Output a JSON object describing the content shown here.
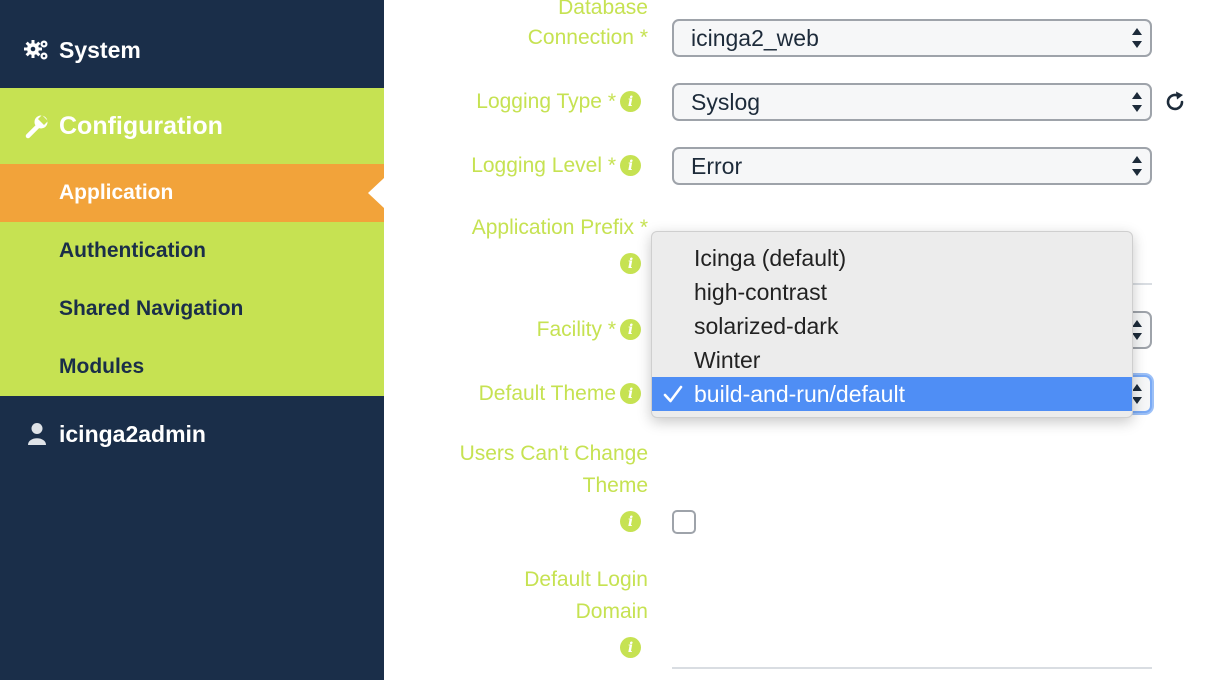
{
  "sidebar": {
    "system_label": "System",
    "configuration_label": "Configuration",
    "sub_items": [
      {
        "label": "Application"
      },
      {
        "label": "Authentication"
      },
      {
        "label": "Shared Navigation"
      },
      {
        "label": "Modules"
      }
    ],
    "user_label": "icinga2admin"
  },
  "form": {
    "database_connection": {
      "label_line1": "Database",
      "label_line2": "Connection *",
      "value": "icinga2_web"
    },
    "logging_type": {
      "label": "Logging Type *",
      "value": "Syslog"
    },
    "logging_level": {
      "label": "Logging Level *",
      "value": "Error"
    },
    "application_prefix": {
      "label": "Application Prefix *"
    },
    "facility": {
      "label": "Facility *"
    },
    "default_theme": {
      "label": "Default Theme",
      "value": "build-and-run/default"
    },
    "users_cant_change_theme": {
      "label_line1": "Users Can't Change",
      "label_line2": "Theme",
      "checked": false
    },
    "default_login_domain": {
      "label_line1": "Default Login",
      "label_line2": "Domain"
    }
  },
  "theme_dropdown": {
    "options": [
      "Icinga (default)",
      "high-contrast",
      "solarized-dark",
      "Winter",
      "build-and-run/default"
    ],
    "selected_index": 4
  },
  "colors": {
    "sidebar_bg": "#1a2e49",
    "accent_green": "#c6e252",
    "active_orange": "#f2a33a",
    "selection_blue": "#4f8ef5"
  },
  "icons": [
    "gears-icon",
    "wrench-icon",
    "user-icon",
    "info-icon",
    "refresh-icon",
    "checkmark-icon",
    "select-arrows-icon"
  ]
}
